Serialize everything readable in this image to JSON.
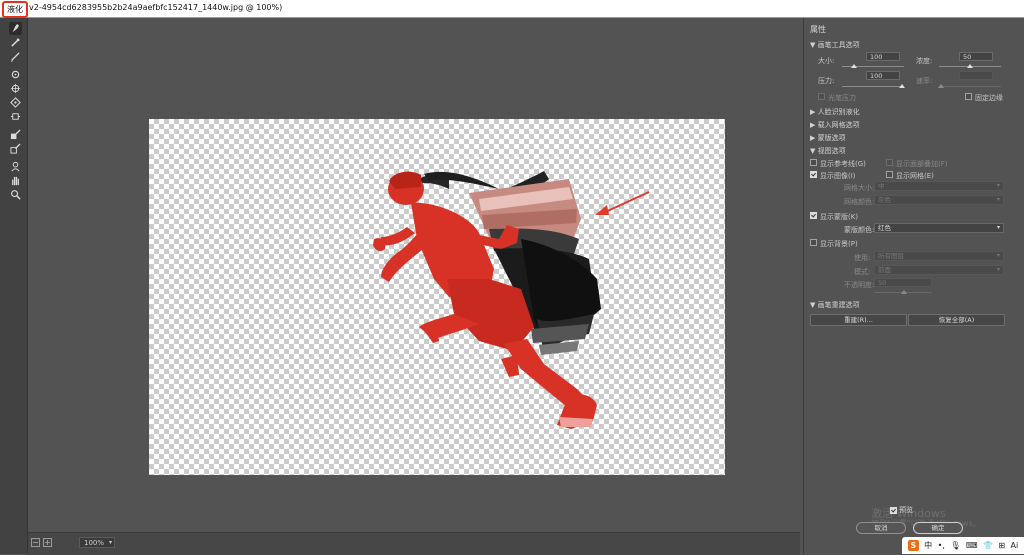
{
  "title_bar": {
    "app_name": "液化",
    "file_name": "v2-4954cd6283955b2b24a9aefbfc152417_1440w.jpg @ 100%)"
  },
  "panel": {
    "header": "属性",
    "brush_section": {
      "title": "画笔工具选项",
      "size_label": "大小:",
      "size_value": "100",
      "size_level_pct": 15,
      "density_label": "浓度:",
      "density_value": "50",
      "density_level_pct": 50,
      "pressure_label": "压力:",
      "pressure_value": "100",
      "pressure_level_pct": 100,
      "rate_label": "速率:",
      "rate_value": "",
      "rate_level_pct": 0,
      "stylus_label": "光笔压力",
      "stylus_checked": false,
      "pin_edges_label": "固定边缘",
      "pin_edges_checked": false
    },
    "face_section": {
      "title": "人脸识别液化"
    },
    "mesh_section": {
      "title": "载入网格选项"
    },
    "mask_section": {
      "title": "蒙版选项"
    },
    "view_section": {
      "title": "视图选项",
      "guides_label": "显示参考线(G)",
      "guides_checked": false,
      "face_overlay_label": "显示面部叠加(F)",
      "face_overlay_checked": false,
      "image_label": "显示图像(I)",
      "image_checked": true,
      "mesh_label": "显示网格(E)",
      "mesh_checked": false,
      "mesh_size_label": "网格大小:",
      "mesh_size_value": "中",
      "mesh_color_label": "网格颜色:",
      "mesh_color_value": "灰色",
      "show_mask_label": "显示蒙版(K)",
      "show_mask_checked": true,
      "mask_color_label": "蒙版颜色:",
      "mask_color_value": "红色",
      "show_backdrop_label": "显示背景(P)",
      "show_backdrop_checked": false,
      "use_label": "使用:",
      "use_value": "所有图层",
      "mode_label": "模式:",
      "mode_value": "前面",
      "opacity_label": "不透明度:",
      "opacity_value": "50",
      "opacity_level_pct": 50
    },
    "reconstruct_section": {
      "title": "画笔重建选项",
      "reconstruct_button": "重建(R)...",
      "restore_all_button": "恢复全部(A)"
    }
  },
  "footer": {
    "preview_label": "预览",
    "cancel_label": "取消",
    "ok_label": "确定",
    "zoom_value": "100%",
    "zoom_out": "−",
    "zoom_in": "+",
    "watermark_line1": "激活 Windows",
    "watermark_line2": "转到\"设置\"以激活 Windows。"
  },
  "ime": {
    "logo": "S",
    "lang": "中",
    "punct": "•,",
    "mic": "🎙",
    "kbd": "⌨",
    "skin": "👕",
    "grid": "⊞",
    "ai": "Ai"
  },
  "colors": {
    "mask_red": "#d83227",
    "arrow_red": "#e23a2a",
    "accent_red": "#e0321e",
    "panel_bg": "#535353"
  },
  "tools": [
    "forward-warp",
    "reconstruct",
    "smooth",
    "twirl-clockwise",
    "pucker",
    "bloat",
    "push-left",
    "freeze-mask",
    "thaw-mask",
    "face",
    "hand",
    "zoom"
  ]
}
